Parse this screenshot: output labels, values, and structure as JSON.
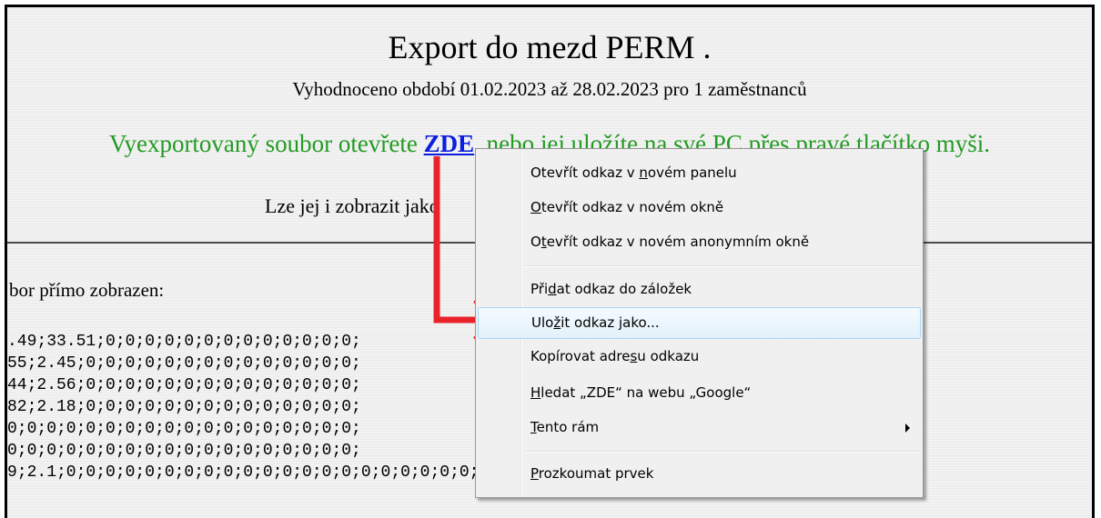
{
  "page": {
    "title": "Export do mezd PERM .",
    "period": "Vyhodnoceno období 01.02.2023 až 28.02.2023 pro 1 zaměstnanců",
    "export_before": "Vyexportovaný soubor otevřete ",
    "export_link": "ZDE",
    "export_after": ", nebo jej uložíte na své PC přes pravé tlačítko myši.",
    "alt_view": "Lze jej i zobrazit jako",
    "shown_label": "bor přímo zobrazen:",
    "csv_lines": [
      ".49;33.51;0;0;0;0;0;0;0;0;0;0;0;0;0;",
      "55;2.45;0;0;0;0;0;0;0;0;0;0;0;0;0;0;",
      "44;2.56;0;0;0;0;0;0;0;0;0;0;0;0;0;0;",
      "82;2.18;0;0;0;0;0;0;0;0;0;0;0;0;0;0;",
      "0;0;0;0;0;0;0;0;0;0;0;0;0;0;0;0;0;0;",
      "0;0;0;0;0;0;0;0;0;0;0;0;0;0;0;0;0;0;",
      "9;2.1;0;0;0;0;0;0;0;0;0;0;0;0;0;0;0;0;0;0;0;0;0;"
    ]
  },
  "context_menu": {
    "items": [
      {
        "before": "Otevřít odkaz v ",
        "key": "n",
        "after": "ovém panelu"
      },
      {
        "before": "",
        "key": "O",
        "after": "tevřít odkaz v novém okně"
      },
      {
        "before": "O",
        "key": "t",
        "after": "evřít odkaz v novém anonymním okně"
      },
      {
        "before": "Při",
        "key": "d",
        "after": "at odkaz do záložek"
      },
      {
        "before": "Ulo",
        "key": "ž",
        "after": "it odkaz jako..."
      },
      {
        "before": "Kopírovat adre",
        "key": "s",
        "after": "u odkazu"
      },
      {
        "before": "",
        "key": "H",
        "after": "ledat „ZDE“ na webu „Google“"
      },
      {
        "before": "",
        "key": "T",
        "after": "ento rám"
      },
      {
        "before": "",
        "key": "P",
        "after": "rozkoumat prvek"
      }
    ],
    "highlighted_item": "Uložit odkaz jako...",
    "highlight_color": "#a8d8f6"
  },
  "annotation": {
    "arrow_color": "#e8232a"
  }
}
